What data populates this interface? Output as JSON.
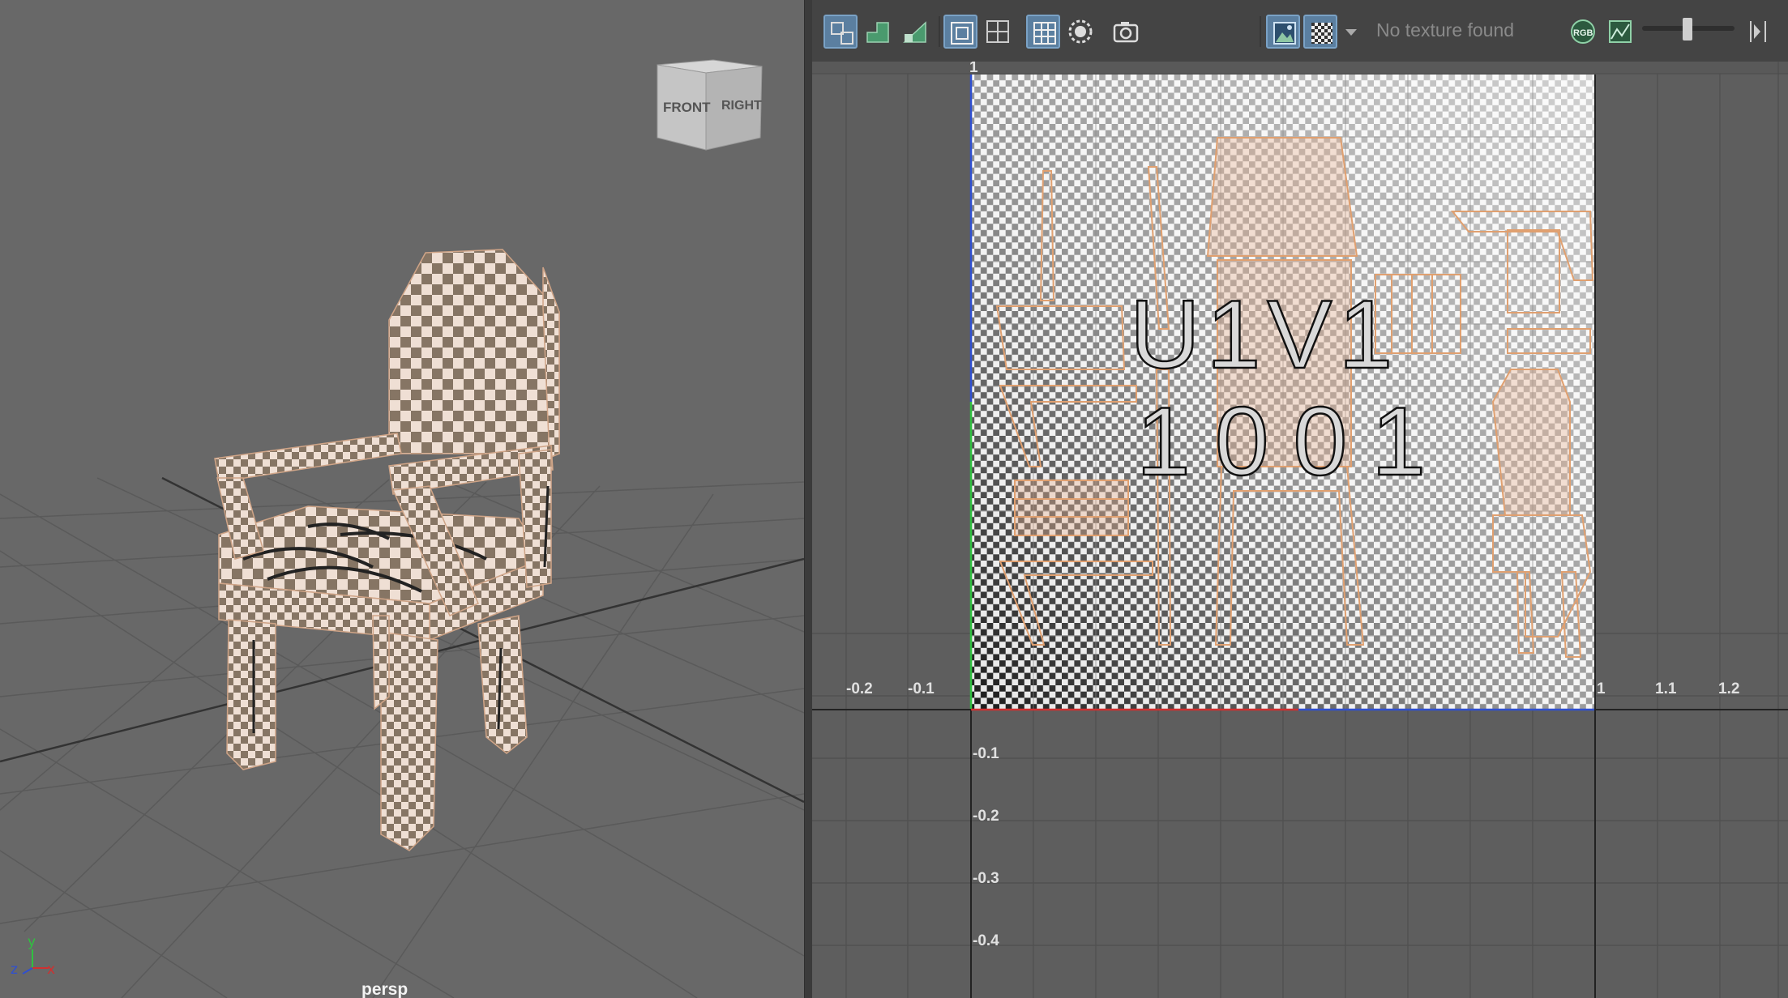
{
  "viewport": {
    "camera_label": "persp",
    "viewcube": {
      "front_label": "FRONT",
      "right_label": "RIGHT"
    },
    "axes": {
      "x": "x",
      "y": "y",
      "z": "z"
    }
  },
  "uv_editor": {
    "no_texture_text": "No texture found",
    "rgb_label": "RGB",
    "tile_label_line1": "U1V1",
    "tile_label_line2": "1001",
    "ruler_top_tick": "1",
    "ruler_x_ticks": [
      "-0.2",
      "-0.1",
      "1",
      "1.1",
      "1.2"
    ],
    "ruler_y_ticks": [
      "-0.1",
      "-0.2",
      "-0.3",
      "-0.4"
    ]
  },
  "colors": {
    "viewport_bg": "#686868",
    "uv_bg": "#5e5e5e",
    "toolbar_bg": "#444444",
    "uv_shell": "#e0a070",
    "active_button": "#5b7fa0",
    "axis_red": "#d03030",
    "axis_green": "#30c040",
    "axis_blue": "#3050d0"
  },
  "icons": [
    "uv-layout-icon",
    "uv-snapshot-icon",
    "uv-shade-icon",
    "grid-frame-icon",
    "grid-icon",
    "pixel-grid-icon",
    "isolate-icon",
    "camera-icon",
    "image-icon",
    "checker-icon",
    "dropdown-arrow-icon",
    "rgb-icon",
    "exposure-icon",
    "slider-icon",
    "step-icon"
  ]
}
